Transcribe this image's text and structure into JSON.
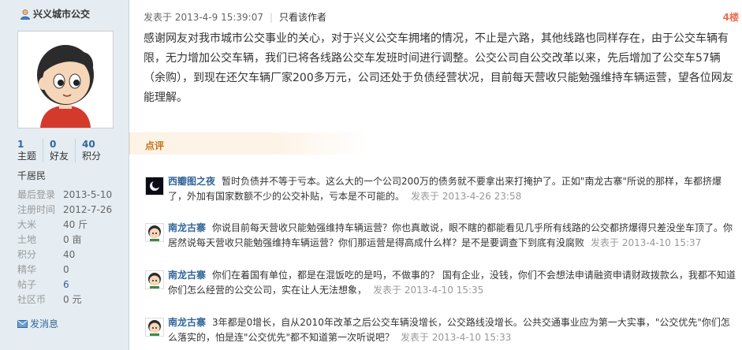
{
  "sidebar": {
    "username": "兴义城市公交",
    "stats": [
      {
        "num": "1",
        "label": "主题"
      },
      {
        "num": "0",
        "label": "好友"
      },
      {
        "num": "40",
        "label": "积分"
      }
    ],
    "rank": "千居民",
    "info": [
      {
        "key": "最后登录",
        "value": "2013-5-10"
      },
      {
        "key": "注册时间",
        "value": "2012-7-26"
      },
      {
        "key": "大米",
        "value": "40 斤"
      },
      {
        "key": "土地",
        "value": "0 亩"
      },
      {
        "key": "积分",
        "value": "40"
      },
      {
        "key": "精华",
        "value": "0"
      },
      {
        "key": "帖子",
        "value": "6"
      },
      {
        "key": "社区币",
        "value": "0 元"
      }
    ],
    "send_message": "发消息"
  },
  "post": {
    "posted_at": "发表于 2013-4-9 15:39:07",
    "author_only": "只看该作者",
    "floor": "4楼",
    "content": "感谢网友对我市城市公交事业的关心，对于兴义公交车拥堵的情况，不止是六路，其他线路也同样存在，由于公交车辆有限，无力增加公交车辆，我们已将各线路公交车发班时间进行调整。公交公司自公交改革以来，先后增加了公交车57辆（余购），到现在还欠车辆厂家200多万元，公司还处于负债经营状况，目前每天营收只能勉强维持车辆运营，望各位网友能理解。"
  },
  "comments_title": "点评",
  "comments": [
    {
      "name": "西瓣图之夜",
      "text": "暂时负债并不等于亏本。这么大的一个公司200万的债务就不要拿出来打掩护了。正如\"南龙古寨\"所说的那样，车都挤爆了，外加有国家数额不少的公交补贴，亏本是不可能的。",
      "time": "发表于 2013-4-26 23:58"
    },
    {
      "name": "南龙古寨",
      "text": "你说目前每天营收只能勉强维持车辆运营？你也真敢说，眼不瞎的都能看见几乎所有线路的公交都挤爆得只差没坐车顶了。你居然说每天营收只能勉强维持车辆运营？你们那运营是得高成什么样？是不是要调查下到底有没腐败",
      "time": "发表于 2013-4-10 15:37"
    },
    {
      "name": "南龙古寨",
      "text": "你们在着国有单位，都是在混饭吃的是吗，不做事的？ 国有企业，没钱，你们不会想法申请融资申请财政拨款么，我都不知道你们怎么经营的公交公司，实在让人无法想象，",
      "time": "发表于 2013-4-10 15:35"
    },
    {
      "name": "南龙古寨",
      "text": "3年都是0增长，自从2010年改革之后公交车辆没增长，公交路线没增长。公共交通事业应为第一大实事，\"公交优先\"你们怎么落实的，怕是连\"公交优先\"都不知道第一次听说吧？",
      "time": "发表于 2013-4-10 15:33"
    }
  ]
}
